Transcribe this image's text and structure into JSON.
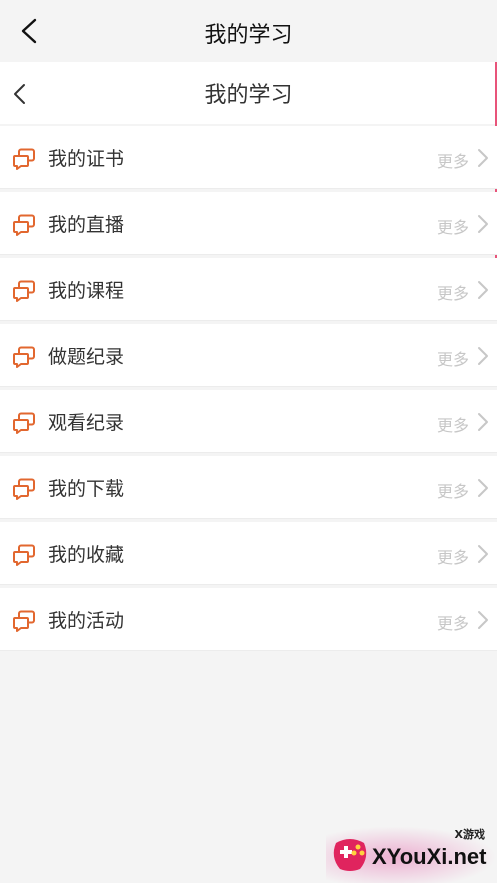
{
  "top_bar": {
    "title": "我的学习",
    "back_icon": "chevron-left-icon"
  },
  "sub_bar": {
    "title": "我的学习",
    "back_icon": "chevron-left-icon"
  },
  "colors": {
    "accent": "#e2672f",
    "more": "#c7c7c7",
    "side_accent": "#e8547a"
  },
  "list": {
    "items": [
      {
        "label": "我的证书",
        "more": "更多",
        "icon": "chat-bubbles-icon"
      },
      {
        "label": "我的直播",
        "more": "更多",
        "icon": "chat-bubbles-icon"
      },
      {
        "label": "我的课程",
        "more": "更多",
        "icon": "chat-bubbles-icon"
      },
      {
        "label": "做题纪录",
        "more": "更多",
        "icon": "chat-bubbles-icon"
      },
      {
        "label": "观看纪录",
        "more": "更多",
        "icon": "chat-bubbles-icon"
      },
      {
        "label": "我的下载",
        "more": "更多",
        "icon": "chat-bubbles-icon"
      },
      {
        "label": "我的收藏",
        "more": "更多",
        "icon": "chat-bubbles-icon"
      },
      {
        "label": "我的活动",
        "more": "更多",
        "icon": "chat-bubbles-icon"
      }
    ]
  },
  "watermark": {
    "small": "X游戏",
    "text": "XYouXi.net"
  }
}
